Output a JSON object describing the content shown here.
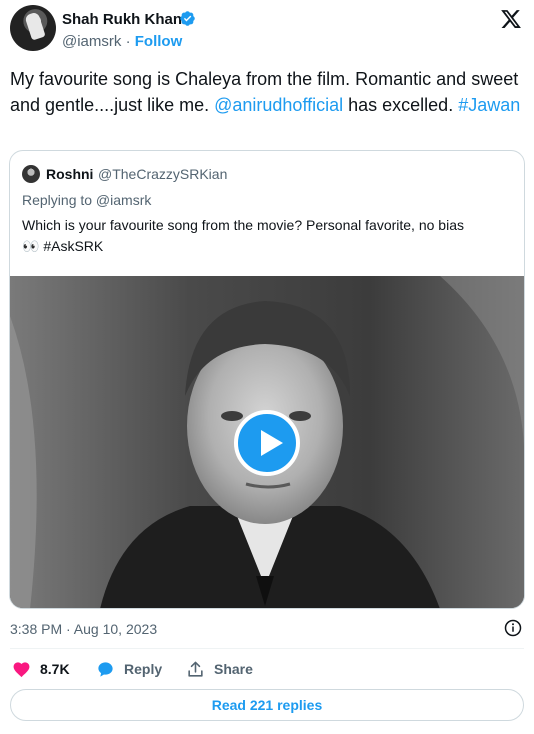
{
  "author": {
    "name": "Shah Rukh Khan",
    "handle": "@iamsrk",
    "separator": "·",
    "follow_label": "Follow",
    "verified": true
  },
  "tweet": {
    "text_before": "My favourite song is Chaleya from the film. Romantic and sweet and gentle....just like me. ",
    "mention": "@anirudhofficial",
    "text_middle": " has excelled. ",
    "hashtag": "#Jawan"
  },
  "quote": {
    "name": "Roshni",
    "handle": "@TheCrazzySRKian",
    "replying_to": "Replying to @iamsrk",
    "text": "Which is your favourite song from the movie? Personal favorite, no bias",
    "emoji": "👀",
    "hashtag": "#AskSRK"
  },
  "media": {
    "type": "video",
    "play_icon": "play-icon"
  },
  "meta": {
    "timestamp": "3:38 PM · Aug 10, 2023"
  },
  "actions": {
    "like_count": "8.7K",
    "reply_label": "Reply",
    "share_label": "Share"
  },
  "read_replies_label": "Read 221 replies",
  "colors": {
    "accent": "#1d9bf0",
    "like": "#f91880",
    "text_primary": "#0f1419",
    "text_secondary": "#536471",
    "border": "#cfd9de"
  }
}
